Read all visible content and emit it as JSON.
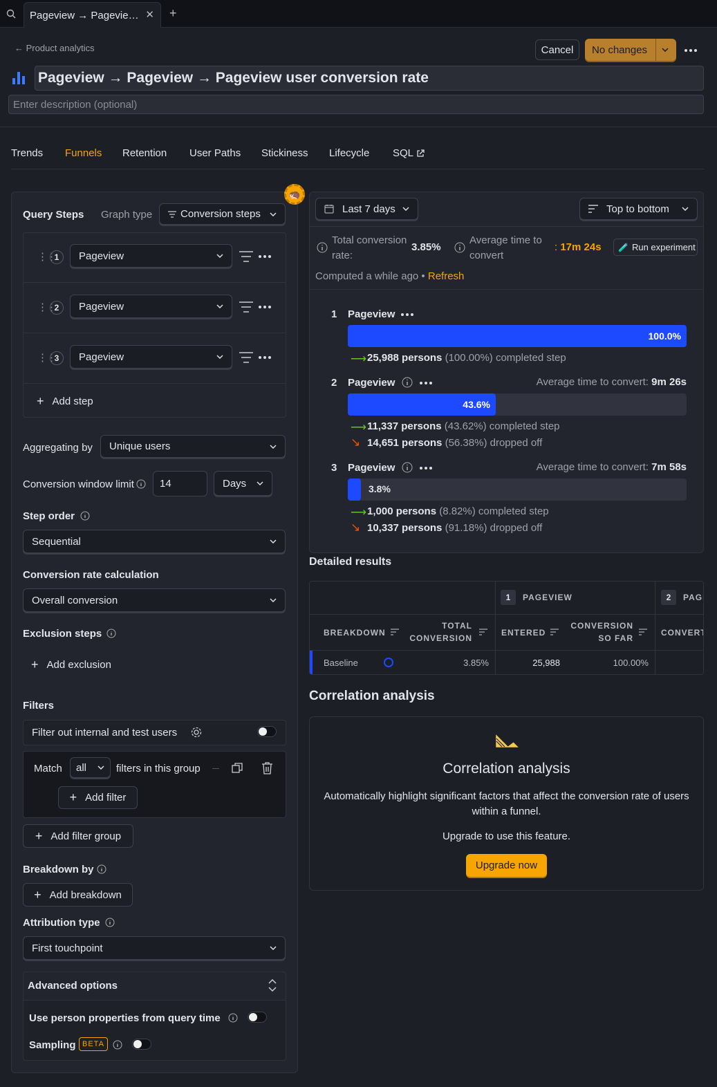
{
  "browser": {
    "tab_title": "Pageview → Pageview → Pageview user conversion rate"
  },
  "header": {
    "breadcrumb": "Product analytics",
    "cancel": "Cancel",
    "save": "No changes",
    "title": "Pageview → Pageview → Pageview user conversion rate",
    "description_placeholder": "Enter description (optional)"
  },
  "nav": {
    "tabs": [
      "Trends",
      "Funnels",
      "Retention",
      "User Paths",
      "Stickiness",
      "Lifecycle",
      "SQL"
    ],
    "active": "Funnels"
  },
  "query": {
    "title": "Query Steps",
    "graph_type_label": "Graph type",
    "graph_type": "Conversion steps",
    "steps": [
      {
        "num": "1",
        "event": "Pageview"
      },
      {
        "num": "2",
        "event": "Pageview"
      },
      {
        "num": "3",
        "event": "Pageview"
      }
    ],
    "add_step": "Add step",
    "aggregating_label": "Aggregating by",
    "aggregating": "Unique users",
    "window_label": "Conversion window limit",
    "window_value": "14",
    "window_unit": "Days",
    "step_order_label": "Step order",
    "step_order": "Sequential",
    "rate_calc_label": "Conversion rate calculation",
    "rate_calc": "Overall conversion",
    "exclusion_label": "Exclusion steps",
    "add_exclusion": "Add exclusion",
    "filters_label": "Filters",
    "filter_internal": "Filter out internal and test users",
    "match": "Match",
    "match_value": "all",
    "match_suffix": "filters in this group",
    "add_filter": "Add filter",
    "add_filter_group": "Add filter group",
    "breakdown_label": "Breakdown by",
    "add_breakdown": "Add breakdown",
    "attribution_label": "Attribution type",
    "attribution": "First touchpoint",
    "advanced_label": "Advanced options",
    "person_props": "Use person properties from query time",
    "sampling": "Sampling",
    "beta": "BETA"
  },
  "results": {
    "date_range": "Last 7 days",
    "layout": "Top to bottom",
    "total_rate_label": "Total conversion rate:",
    "total_rate": "3.85%",
    "avg_time_label": "Average time to convert",
    "avg_time": "17m 24s",
    "run_experiment": "Run experiment",
    "computed": "Computed a while ago",
    "refresh": "Refresh",
    "steps": [
      {
        "num": "1",
        "name": "Pageview",
        "bar_pct": 100,
        "bar_label": "100.0%",
        "completed": "25,988 persons",
        "completed_pct": "(100.00%) completed step",
        "avg_label": "",
        "avg_value": "",
        "dropped": "",
        "dropped_pct": ""
      },
      {
        "num": "2",
        "name": "Pageview",
        "bar_pct": 43.6,
        "bar_label": "43.6%",
        "completed": "11,337 persons",
        "completed_pct": "(43.62%) completed step",
        "avg_label": "Average time to convert:",
        "avg_value": "9m 26s",
        "dropped": "14,651 persons",
        "dropped_pct": "(56.38%) dropped off"
      },
      {
        "num": "3",
        "name": "Pageview",
        "bar_pct": 3.8,
        "bar_label": "3.8%",
        "completed": "1,000 persons",
        "completed_pct": "(8.82%) completed step",
        "avg_label": "Average time to convert:",
        "avg_value": "7m 58s",
        "dropped": "10,337 persons",
        "dropped_pct": "(91.18%) dropped off"
      }
    ]
  },
  "detailed": {
    "title": "Detailed results",
    "step1_num": "1",
    "step1": "PAGEVIEW",
    "step2_num": "2",
    "step2": "PAGEVIEW",
    "cols": {
      "breakdown": "BREAKDOWN",
      "total1": "TOTAL",
      "total2": "CONVERSION",
      "entered": "ENTERED",
      "conv1": "CONVERSION",
      "conv2": "SO FAR",
      "convert": "CONVERTED"
    },
    "row": {
      "name": "Baseline",
      "total": "3.85%",
      "entered": "25,988",
      "so_far": "100.00%"
    }
  },
  "correlation": {
    "section": "Correlation analysis",
    "title": "Correlation analysis",
    "desc": "Automatically highlight significant factors that affect the conversion rate of users within a funnel.",
    "upgrade_text": "Upgrade to use this feature.",
    "upgrade_btn": "Upgrade now"
  },
  "colors": {
    "accent": "#f7a501",
    "bar": "#1d4aff",
    "success": "#6bc426",
    "danger": "#f54e00"
  }
}
